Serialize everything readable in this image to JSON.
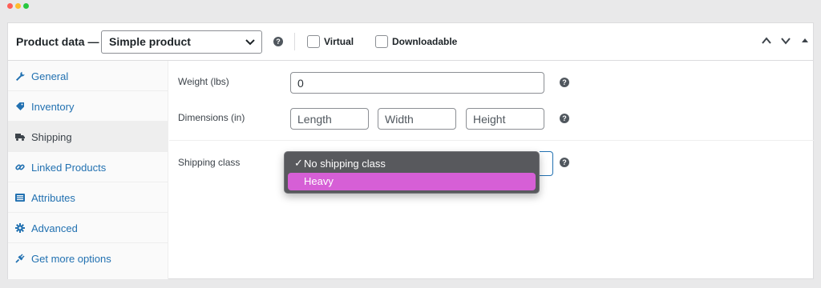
{
  "window": {
    "controls": [
      {
        "name": "close",
        "color": "#fe5f57"
      },
      {
        "name": "minimize",
        "color": "#febc2e"
      },
      {
        "name": "maximize",
        "color": "#28c840"
      }
    ]
  },
  "header": {
    "title": "Product data —",
    "product_type": "Simple product",
    "help_glyph": "?",
    "virtual_label": "Virtual",
    "downloadable_label": "Downloadable"
  },
  "sidebar": {
    "items": [
      {
        "label": "General",
        "icon": "wrench-icon"
      },
      {
        "label": "Inventory",
        "icon": "tag-icon"
      },
      {
        "label": "Shipping",
        "icon": "truck-icon",
        "active": true
      },
      {
        "label": "Linked Products",
        "icon": "link-icon"
      },
      {
        "label": "Attributes",
        "icon": "list-icon"
      },
      {
        "label": "Advanced",
        "icon": "gear-icon"
      },
      {
        "label": "Get more options",
        "icon": "plugin-icon"
      }
    ]
  },
  "shipping": {
    "weight_label": "Weight (lbs)",
    "weight_value": "0",
    "dimensions_label": "Dimensions (in)",
    "length_placeholder": "Length",
    "width_placeholder": "Width",
    "height_placeholder": "Height",
    "class_label": "Shipping class",
    "class_options": [
      "No shipping class",
      "Heavy"
    ],
    "selected_option": "No shipping class",
    "highlighted_option": "Heavy",
    "check_glyph": "✓"
  },
  "colors": {
    "link": "#2271b1",
    "highlight": "#d65fd6",
    "dropdown_bg": "#58595d"
  }
}
